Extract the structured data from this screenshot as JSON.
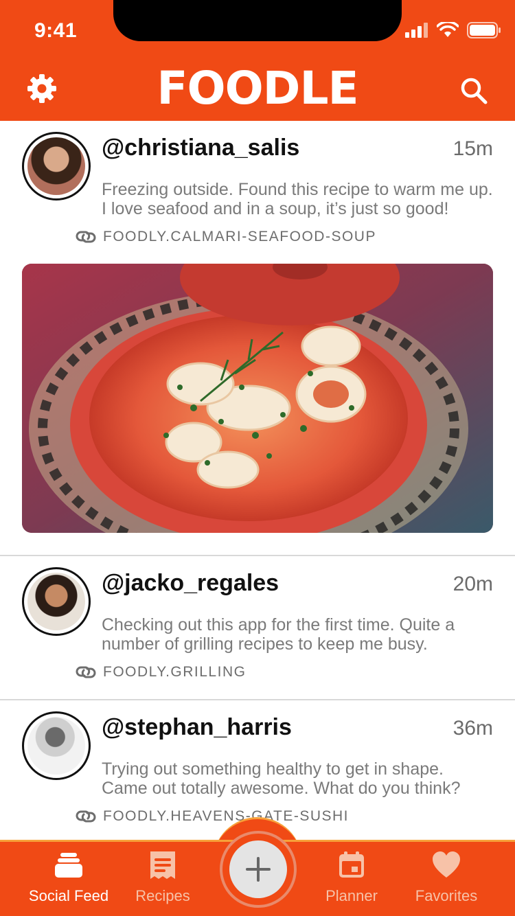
{
  "status_bar": {
    "time": "9:41"
  },
  "header": {
    "logo": "FOODLE"
  },
  "posts": [
    {
      "username": "@christiana_salis",
      "time": "15m",
      "text": "Freezing outside. Found this recipe to warm me up. I love seafood and in a soup, it’s just so good!",
      "link": "FOODLY.CALMARI-SEAFOOD-SOUP"
    },
    {
      "username": "@jacko_regales",
      "time": "20m",
      "text": "Checking out this app for the first time. Quite a number of grilling recipes to keep me busy.",
      "link": "FOODLY.GRILLING"
    },
    {
      "username": "@stephan_harris",
      "time": "36m",
      "text": "Trying out something healthy to get in shape. Came out totally awesome. What do you think?",
      "link": "FOODLY.HEAVENS-GATE-SUSHI"
    }
  ],
  "tabs": [
    {
      "label": "Social Feed",
      "icon": "social-feed-icon",
      "active": true
    },
    {
      "label": "Recipes",
      "icon": "recipes-icon",
      "active": false
    },
    {
      "label": "Planner",
      "icon": "calendar-icon",
      "active": false
    },
    {
      "label": "Favorites",
      "icon": "heart-icon",
      "active": false
    }
  ],
  "colors": {
    "brand": "#f04a15",
    "accent": "#f7a13a",
    "inactive_tab": "#f7c2a8"
  }
}
